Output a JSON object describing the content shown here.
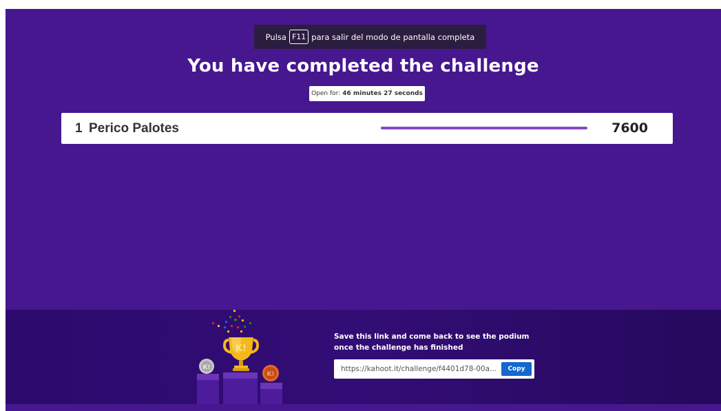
{
  "fullscreen_banner": {
    "prefix": "Pulsa",
    "key": "F11",
    "suffix": "para salir del modo de pantalla completa"
  },
  "title": "You have completed the challenge",
  "open_for": {
    "label": "Open for:",
    "value": "46 minutes 27 seconds"
  },
  "leaderboard": [
    {
      "rank": "1",
      "name": "Perico Palotes",
      "score": "7600",
      "progress": 1.0
    }
  ],
  "footer": {
    "save_message_line1": "Save this link and come back to see the podium",
    "save_message_line2": "once the challenge has finished",
    "link_value": "https://kahoot.it/challenge/f4401d78-00a...",
    "copy_label": "Copy"
  },
  "colors": {
    "background": "#46178f",
    "footer": "#2c0a6d",
    "progress_bar": "#8847c6",
    "copy_button": "#1368ce",
    "trophy": "#f5b81a"
  }
}
